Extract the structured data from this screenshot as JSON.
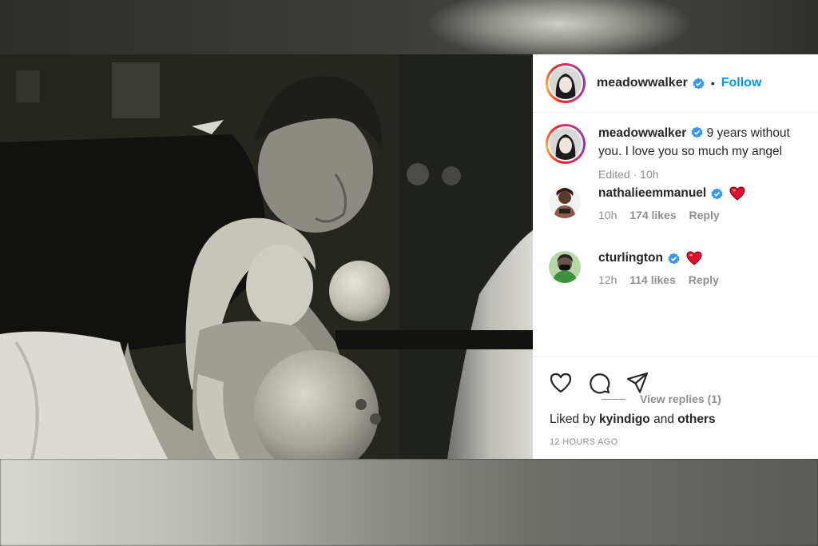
{
  "post": {
    "author": {
      "username": "meadowwalker",
      "verified": true,
      "separator": "•",
      "follow_label": "Follow"
    },
    "caption": {
      "username": "meadowwalker",
      "text": "9 years without you. I love you so much my angel",
      "edited_label": "Edited",
      "meta_separator": "·",
      "time": "10h"
    },
    "comments": [
      {
        "username": "nathalieemmanuel",
        "verified": true,
        "emoji": "heart",
        "time": "10h",
        "likes": "174 likes",
        "reply_label": "Reply"
      },
      {
        "username": "cturlington",
        "verified": true,
        "emoji": "heart",
        "time": "12h",
        "likes": "114 likes",
        "reply_label": "Reply"
      }
    ],
    "view_replies_label": "View replies (1)",
    "actions": [
      "heart-icon",
      "comment-icon",
      "share-icon"
    ],
    "liked_by": {
      "prefix": "Liked by",
      "user": "kyindigo",
      "conjunction": "and",
      "others": "others"
    },
    "timestamp": "12 HOURS AGO"
  },
  "colors": {
    "link_blue": "#0095f6",
    "verified_blue": "#3897f0",
    "heart_red": "#e0102c",
    "muted_gray": "#8e8e8e",
    "text_dark": "#262626"
  }
}
